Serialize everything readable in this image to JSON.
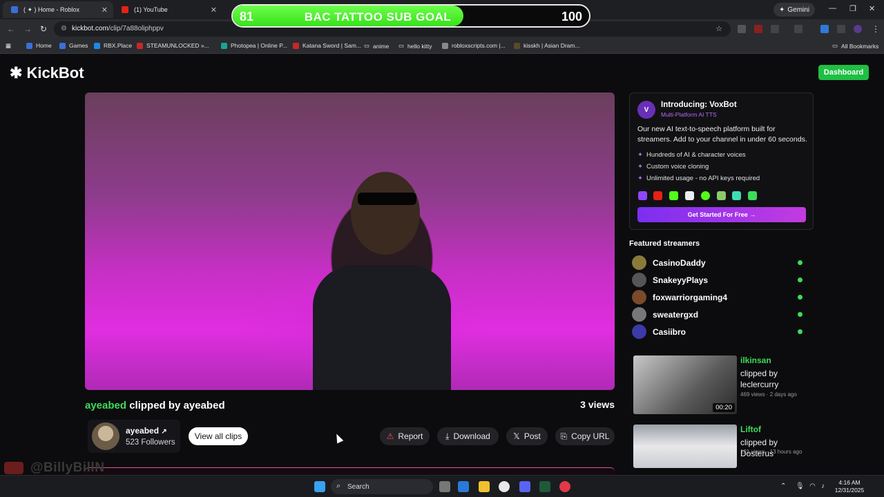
{
  "browser": {
    "tabs": [
      {
        "title": "( ✦ ) Home - Roblox",
        "color": "#3b6ed8"
      },
      {
        "title": "(1) YouTube",
        "color": "#e62117"
      }
    ],
    "gemini_label": "Gemini",
    "url_host": "kickbot.com",
    "url_path": "/clip/7a88oliphppv",
    "bookmarks": [
      "Home",
      "Games",
      "RBX.Place",
      "STEAMUNLOCKED »...",
      "Photopea | Online P...",
      "Katana Sword | Sam...",
      "anime",
      "hello kitty",
      "robloxscripts.com |...",
      "kisskh | Asian Dram...",
      "All Bookmarks"
    ]
  },
  "sub_goal": {
    "current": "81",
    "title": "BAC TATTOO SUB GOAL",
    "goal": "100",
    "progress_fraction": 0.81
  },
  "site": {
    "logo": "KickBot",
    "dashboard_label": "Dashboard"
  },
  "clip": {
    "channel": "ayeabed",
    "clipped_by_text": "clipped by ayeabed",
    "views": "3 views",
    "creator_name": "ayeabed",
    "followers": "523 Followers",
    "view_all_label": "View all clips",
    "actions": {
      "report": "Report",
      "download": "Download",
      "post": "Post",
      "copy_url": "Copy URL"
    }
  },
  "promo": {
    "title": "Introducing: VoxBot",
    "subtitle": "Multi-Platform AI TTS",
    "description": "Our new AI text-to-speech platform built for streamers. Add to your channel in under 60 seconds.",
    "features": [
      "Hundreds of AI & character voices",
      "Custom voice cloning",
      "Unlimited usage - no API keys required"
    ],
    "cta": "Get Started For Free →"
  },
  "featured": {
    "heading": "Featured streamers",
    "streamers": [
      {
        "name": "CasinoDaddy",
        "color": "#8a7a3a"
      },
      {
        "name": "SnakeyyPlays",
        "color": "#555555"
      },
      {
        "name": "foxwarriorgaming4",
        "color": "#7a4a2a"
      },
      {
        "name": "sweatergxd",
        "color": "#777777"
      },
      {
        "name": "Casiibro",
        "color": "#3a3aa8"
      }
    ]
  },
  "related": [
    {
      "channel": "ilkinsan",
      "by": "clipped by leclercurry",
      "meta": "469 views · 2 days ago",
      "duration": "00:20"
    },
    {
      "channel": "Liftof",
      "by": "clipped by Dosterus",
      "meta": "121 views · 13 hours ago",
      "duration": ""
    }
  ],
  "watermark": "@BillyBillN",
  "taskbar": {
    "search": "Search",
    "time": "4:16 AM",
    "date": "12/31/2025"
  }
}
